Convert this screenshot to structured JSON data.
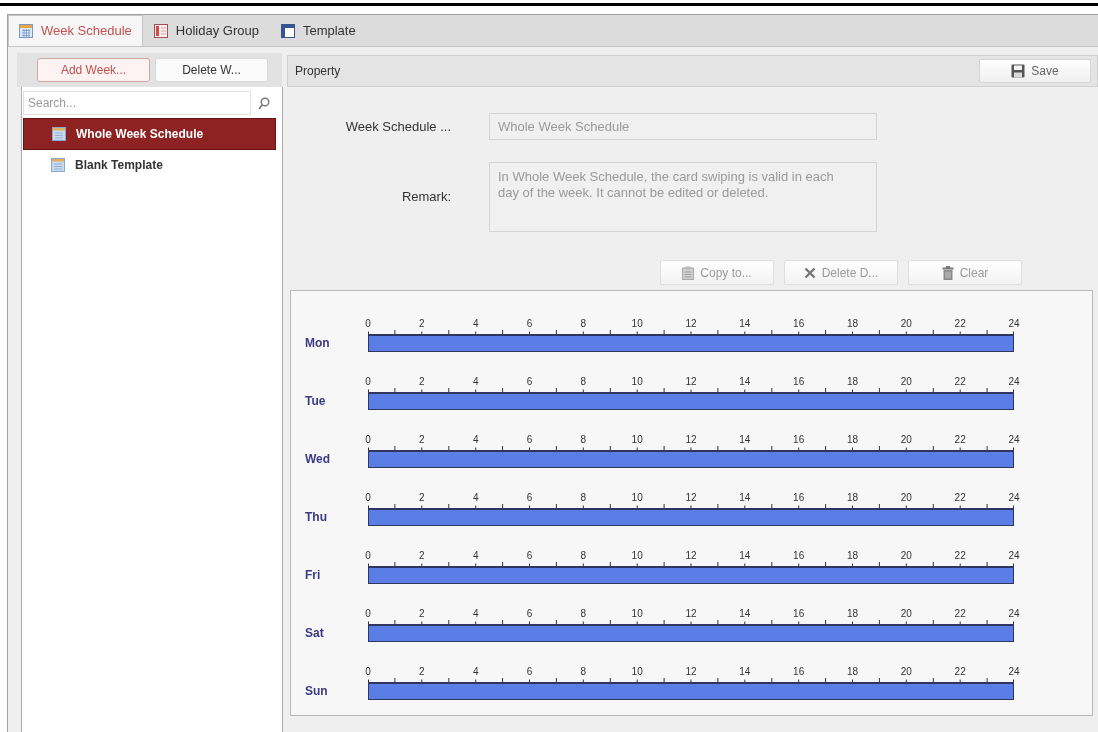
{
  "tabs": [
    {
      "label": "Week Schedule",
      "selected": true
    },
    {
      "label": "Holiday Group",
      "selected": false
    },
    {
      "label": "Template",
      "selected": false
    }
  ],
  "sidebar": {
    "buttons": [
      {
        "label": "Add Week...",
        "highlighted": true
      },
      {
        "label": "Delete W...",
        "highlighted": false
      }
    ],
    "search": {
      "placeholder": "Search..."
    },
    "items": [
      {
        "label": "Whole Week Schedule",
        "selected": true
      },
      {
        "label": "Blank Template",
        "selected": false
      }
    ]
  },
  "property": {
    "title": "Property",
    "save": "Save",
    "fields": [
      {
        "kind": "input",
        "label": "Week Schedule ...",
        "value": "Whole Week Schedule",
        "disabled": true
      },
      {
        "kind": "textarea",
        "label": "Remark:",
        "value": "In Whole Week Schedule, the card swiping is valid in each day of the week. It cannot be edited or deleted.",
        "disabled": true
      }
    ],
    "actions": [
      {
        "kind": "copy",
        "label": "Copy to...",
        "disabled": true
      },
      {
        "kind": "delete",
        "label": "Delete D...",
        "disabled": true
      },
      {
        "kind": "clear",
        "label": "Clear",
        "disabled": true
      }
    ]
  },
  "schedule": {
    "days": [
      {
        "label": "Mon",
        "ticks": [
          "0",
          "2",
          "4",
          "6",
          "8",
          "10",
          "12",
          "14",
          "16",
          "18",
          "20",
          "22",
          "24"
        ],
        "level": 1
      },
      {
        "label": "Tue",
        "ticks": [
          "0",
          "2",
          "4",
          "6",
          "8",
          "10",
          "12",
          "14",
          "16",
          "18",
          "20",
          "22",
          "24"
        ],
        "level": 1
      },
      {
        "label": "Wed",
        "ticks": [
          "0",
          "2",
          "4",
          "6",
          "8",
          "10",
          "12",
          "14",
          "16",
          "18",
          "20",
          "22",
          "24"
        ],
        "level": 1
      },
      {
        "label": "Thu",
        "ticks": [
          "0",
          "2",
          "4",
          "6",
          "8",
          "10",
          "12",
          "14",
          "16",
          "18",
          "20",
          "22",
          "24"
        ],
        "level": 1
      },
      {
        "label": "Fri",
        "ticks": [
          "0",
          "2",
          "4",
          "6",
          "8",
          "10",
          "12",
          "14",
          "16",
          "18",
          "20",
          "22",
          "24"
        ],
        "level": 1
      },
      {
        "label": "Sat",
        "ticks": [
          "0",
          "2",
          "4",
          "6",
          "8",
          "10",
          "12",
          "14",
          "16",
          "18",
          "20",
          "22",
          "24"
        ],
        "level": 1
      },
      {
        "label": "Sun",
        "ticks": [
          "0",
          "2",
          "4",
          "6",
          "8",
          "10",
          "12",
          "14",
          "16",
          "18",
          "20",
          "22",
          "24"
        ],
        "level": 1
      }
    ]
  }
}
